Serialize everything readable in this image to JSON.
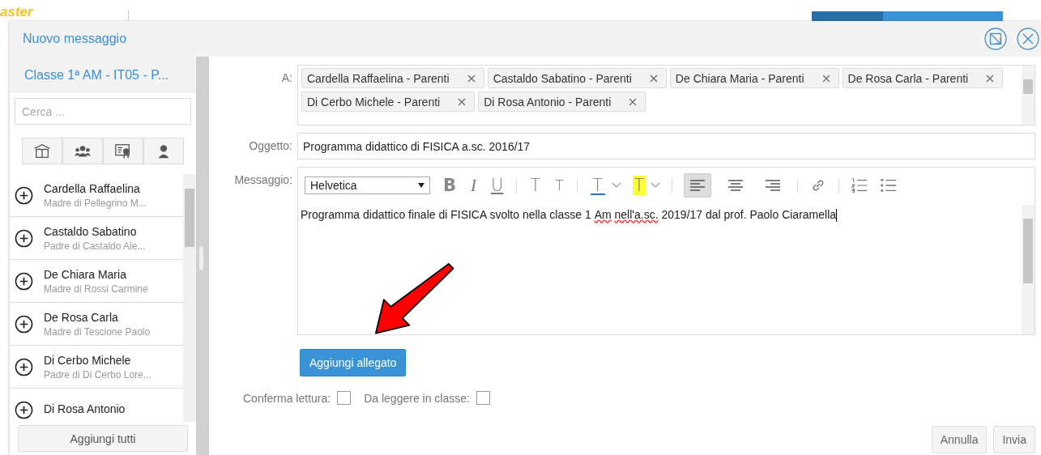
{
  "background": {
    "logo": "aster"
  },
  "dialog": {
    "title": "Nuovo messaggio"
  },
  "sidebar": {
    "class_name": "Classe 1ª AM - IT05 - P...",
    "search": {
      "placeholder": "Cerca ..."
    },
    "filters": [
      {
        "kind": "building",
        "selected": false
      },
      {
        "kind": "group",
        "selected": false
      },
      {
        "kind": "certificate",
        "selected": false
      },
      {
        "kind": "person",
        "selected": false
      }
    ],
    "contacts": [
      {
        "name": "Cardella Raffaelina",
        "relation": "Madre di Pellegrino M..."
      },
      {
        "name": "Castaldo Sabatino",
        "relation": "Padre di Castaldo Ale..."
      },
      {
        "name": "De Chiara Maria",
        "relation": "Madre di Rossi Carmine"
      },
      {
        "name": "De Rosa Carla",
        "relation": "Madre di Tescione Paolo"
      },
      {
        "name": "Di Cerbo Michele",
        "relation": "Padre di Di Cerbo Lore..."
      },
      {
        "name": "Di Rosa Antonio"
      }
    ],
    "add_all": "Aggiungi tutti"
  },
  "form": {
    "to_label": "A:",
    "recipients": [
      "Cardella Raffaelina - Parenti",
      "Castaldo Sabatino - Parenti",
      "De Chiara Maria - Parenti",
      "De Rosa Carla - Parenti",
      "Di Cerbo Michele - Parenti",
      "Di Rosa Antonio - Parenti"
    ],
    "subject_label": "Oggetto:",
    "subject": "Programma didattico di FISICA a.sc. 2016/17",
    "message_label": "Messaggio:",
    "font": "Helvetica",
    "toolbar": [
      {
        "kind": "bold",
        "glyph": "B",
        "selected": false
      },
      {
        "kind": "italic",
        "glyph": "I",
        "selected": false
      },
      {
        "kind": "underline",
        "glyph": "U",
        "selected": false
      },
      {
        "kind": "sep"
      },
      {
        "kind": "grow",
        "glyph": "T",
        "selected": false
      },
      {
        "kind": "shrink",
        "glyph": "T",
        "selected": false
      },
      {
        "kind": "sep"
      },
      {
        "kind": "text-color",
        "glyph": "T",
        "selected": false,
        "color": "#1f7fd0"
      },
      {
        "kind": "caret"
      },
      {
        "kind": "highlight",
        "glyph": "T",
        "selected": false,
        "color": "#ffff33"
      },
      {
        "kind": "caret"
      },
      {
        "kind": "sep"
      },
      {
        "kind": "align-left",
        "selected": true
      },
      {
        "kind": "align-center",
        "selected": false
      },
      {
        "kind": "align-right",
        "selected": false
      },
      {
        "kind": "sep"
      },
      {
        "kind": "link"
      },
      {
        "kind": "sep"
      },
      {
        "kind": "ordered-list"
      },
      {
        "kind": "bullet-list"
      }
    ],
    "body": [
      {
        "text": "Programma didattico finale di FISICA svolto nella classe 1",
        "misspelled": false
      },
      {
        "text": "Am",
        "misspelled": true
      },
      {
        "text": "nell'a.sc.",
        "misspelled": true
      },
      {
        "text": "2019/17 dal prof. Paolo Ciaramella",
        "misspelled": false
      }
    ],
    "attach": "Aggiungi allegato",
    "options": [
      {
        "label": "Conferma lettura:",
        "checked": false
      },
      {
        "label": "Da leggere in classe:",
        "checked": false
      }
    ],
    "buttons": [
      "Annulla",
      "Invia"
    ]
  }
}
